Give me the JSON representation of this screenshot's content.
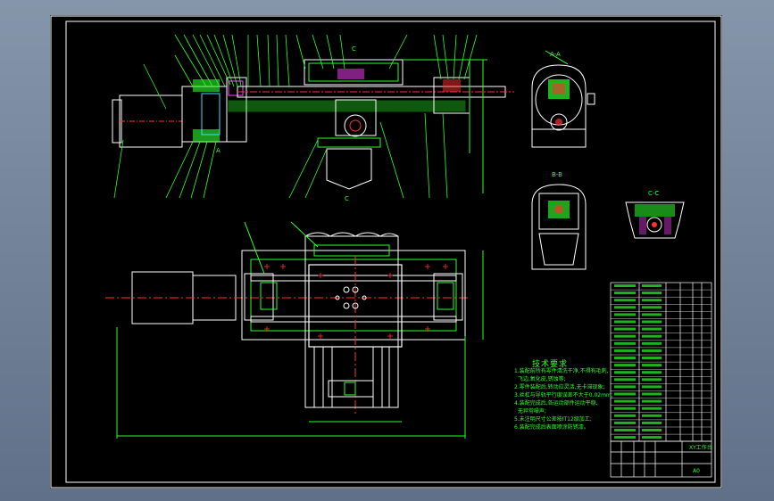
{
  "drawing": {
    "section_labels": {
      "aa": "A-A",
      "bb": "B-B",
      "cc": "C-C",
      "c_top": "C",
      "c_bottom": "C",
      "a_mark": "A"
    },
    "technical_requirements": {
      "title": "技术要求",
      "lines": [
        "1.装配前所有零件清洗干净,不得有毛刺,",
        "  飞边,氧化皮,锈蚀等;",
        "2.零件装配后,转动应灵活,无卡滞现象;",
        "3.丝杠与导轨平行度误差不大于0.02mm;",
        "4.装配完成后,各运动部件运动平稳,",
        "  无异常噪声;",
        "5.未注明尺寸公差按IT12级加工;",
        "6.装配完成后表面喷涂防锈漆。"
      ]
    },
    "title_block": {
      "name": "XY工作台",
      "sheet": "A0"
    }
  },
  "colors": {
    "line_green": "#2cff2c",
    "white": "#ffffff",
    "red": "#ff3030",
    "cyan": "#39e0ff",
    "yellow": "#ffff33",
    "magenta": "#ff40ff",
    "frame_bg": "#000000"
  }
}
